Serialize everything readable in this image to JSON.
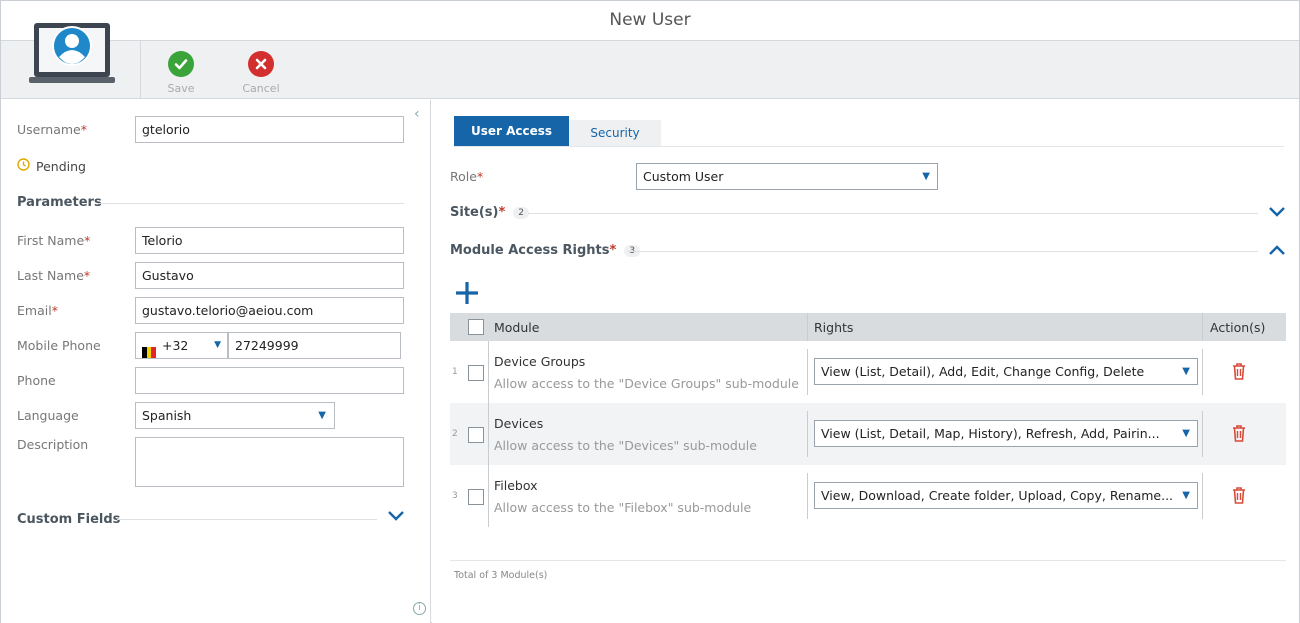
{
  "window": {
    "title": "New User"
  },
  "toolbar": {
    "save_label": "Save",
    "cancel_label": "Cancel"
  },
  "form": {
    "username": {
      "label": "Username",
      "value": "gtelorio"
    },
    "status": "Pending",
    "parameters_heading": "Parameters",
    "first_name": {
      "label": "First Name",
      "value": "Telorio"
    },
    "last_name": {
      "label": "Last Name",
      "value": "Gustavo"
    },
    "email": {
      "label": "Email",
      "value": "gustavo.telorio@aeiou.com"
    },
    "mobile_phone": {
      "label": "Mobile Phone",
      "country_code": "+32",
      "value": "27249999"
    },
    "phone": {
      "label": "Phone",
      "value": ""
    },
    "language": {
      "label": "Language",
      "value": "Spanish"
    },
    "description": {
      "label": "Description",
      "value": ""
    },
    "custom_fields_heading": "Custom Fields",
    "required_mark": "*"
  },
  "tabs": {
    "user_access": "User Access",
    "security": "Security"
  },
  "access": {
    "role": {
      "label": "Role",
      "value": "Custom User"
    },
    "sites": {
      "label": "Site(s)",
      "count": "2"
    },
    "modules": {
      "label": "Module Access Rights",
      "count": "3"
    },
    "add_icon": "plus-icon",
    "columns": {
      "module": "Module",
      "rights": "Rights",
      "actions": "Action(s)"
    },
    "rows": [
      {
        "num": "1",
        "title": "Device Groups",
        "desc": "Allow access to the \"Device Groups\" sub-module",
        "rights": "View (List, Detail), Add, Edit, Change Config, Delete"
      },
      {
        "num": "2",
        "title": "Devices",
        "desc": "Allow access to the \"Devices\" sub-module",
        "rights": "View (List, Detail, Map, History), Refresh, Add, Pairin..."
      },
      {
        "num": "3",
        "title": "Filebox",
        "desc": "Allow access to the \"Filebox\" sub-module",
        "rights": "View, Download, Create folder, Upload, Copy, Rename..."
      }
    ],
    "footer": "Total of 3 Module(s)"
  },
  "colors": {
    "accent": "#1565a8",
    "save": "#3aa33a",
    "cancel": "#d32f2f",
    "required": "#c0392b",
    "pending": "#e0a800"
  }
}
